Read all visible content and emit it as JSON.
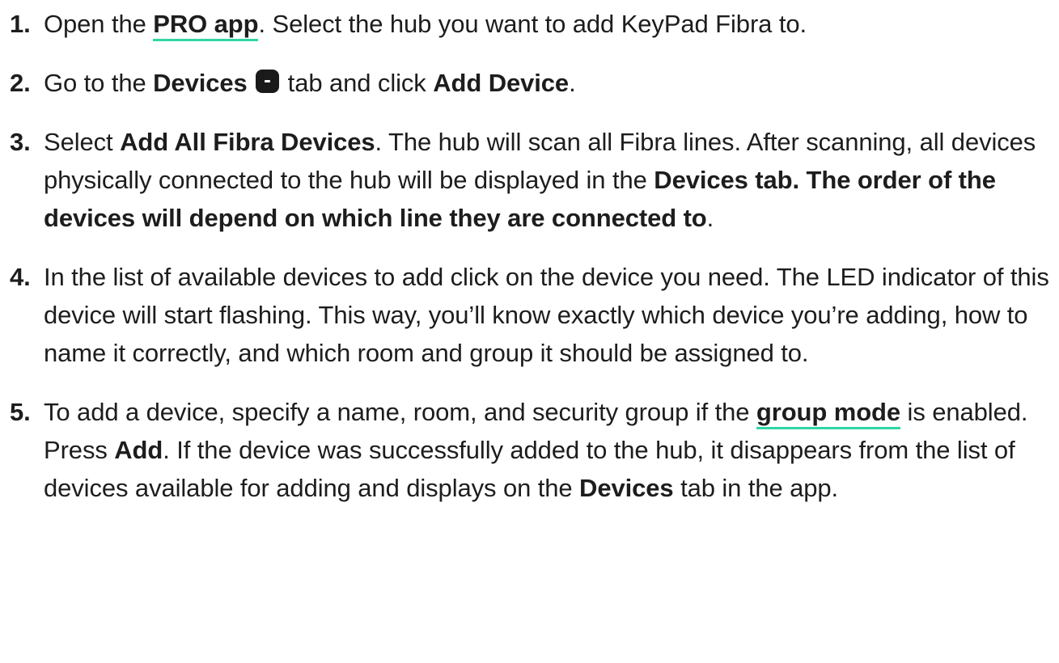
{
  "steps": [
    {
      "num": "1.",
      "t1": "Open the ",
      "link": "PRO app",
      "t2": ". Select the hub you want to add KeyPad Fibra to."
    },
    {
      "num": "2.",
      "t1": "Go to the ",
      "b1": "Devices",
      "icon": "devices-tab-icon",
      "t2": " tab and click ",
      "b2": "Add Device",
      "t3": "."
    },
    {
      "num": "3.",
      "t1": "Select ",
      "b1": "Add All Fibra Devices",
      "t2": ". The hub will scan all Fibra lines. After scanning, all devices physically connected to the hub will be displayed in the ",
      "b2": "Devices tab. The order of the devices will depend on which line they are connected to",
      "t3": "."
    },
    {
      "num": "4.",
      "t1": "In the list of available devices to add click on the device you need. The LED indicator of this device will start flashing. This way, you’ll know exactly which device you’re adding, how to name it correctly, and which room and group it should be assigned to."
    },
    {
      "num": "5.",
      "t1": "To add a device, specify a name, room, and security group if the ",
      "link": "group mode",
      "t2": " is enabled. Press ",
      "b1": "Add",
      "t3": ". If the device was successfully added to the hub, it disappears from the list of devices available for adding and displays on the ",
      "b2": "Devices",
      "t4": " tab in the app."
    }
  ],
  "colors": {
    "text": "#1d1d1d",
    "link_underline": "#2fd6a4",
    "icon_bg": "#1a1a1a"
  }
}
